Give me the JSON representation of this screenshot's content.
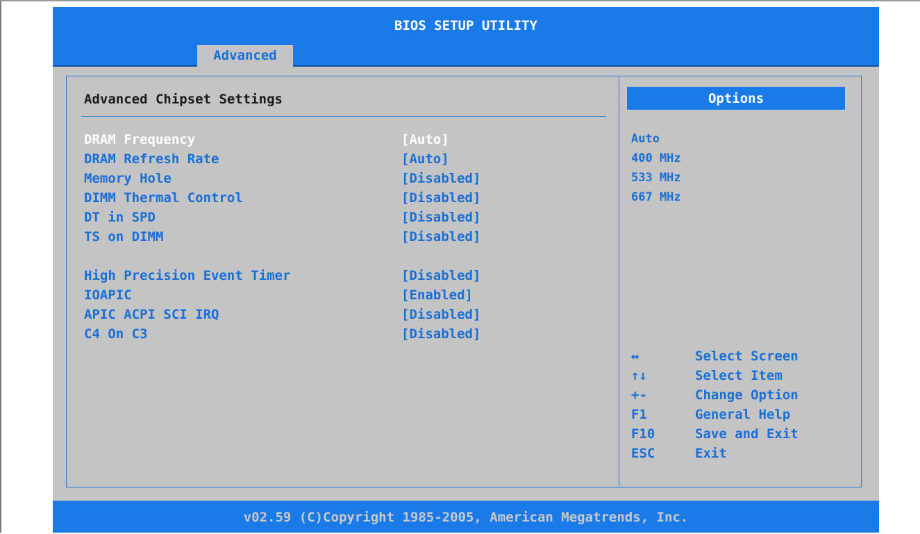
{
  "title": "BIOS SETUP UTILITY",
  "tabs": [
    {
      "label": "Advanced",
      "active": true
    }
  ],
  "section": {
    "title": "Advanced Chipset Settings"
  },
  "settings": [
    {
      "label": "DRAM Frequency",
      "value": "[Auto]",
      "selected": true
    },
    {
      "label": "DRAM Refresh Rate",
      "value": "[Auto]"
    },
    {
      "label": "Memory Hole",
      "value": "[Disabled]"
    },
    {
      "label": "DIMM Thermal Control",
      "value": "[Disabled]"
    },
    {
      "label": "DT in SPD",
      "value": "[Disabled]"
    },
    {
      "label": "TS on DIMM",
      "value": "[Disabled]"
    },
    {
      "label": "High Precision Event Timer",
      "value": "[Disabled]"
    },
    {
      "label": "IOAPIC",
      "value": "[Enabled]"
    },
    {
      "label": "APIC ACPI SCI IRQ",
      "value": "[Disabled]"
    },
    {
      "label": "C4 On C3",
      "value": "[Disabled]"
    }
  ],
  "options_panel": {
    "header": "Options",
    "items": [
      "Auto",
      "400 MHz",
      "533 MHz",
      "667 MHz"
    ]
  },
  "help": [
    {
      "key": "↔",
      "action": "Select Screen",
      "icon": "left-right-arrow-icon"
    },
    {
      "key": "↑↓",
      "action": "Select Item",
      "icon": "up-down-arrow-icon"
    },
    {
      "key": "+-",
      "action": "Change Option"
    },
    {
      "key": "F1",
      "action": "General Help"
    },
    {
      "key": "F10",
      "action": "Save and Exit"
    },
    {
      "key": "ESC",
      "action": "Exit"
    }
  ],
  "footer": "v02.59 (C)Copyright 1985-2005, American Megatrends, Inc.",
  "colors": {
    "accent_blue": "#1a7be8",
    "panel_gray": "#c4c4c4",
    "text_blue": "#1a6fd6",
    "text_dark": "#1b1b1b",
    "footer_text": "#c8c8c8"
  }
}
